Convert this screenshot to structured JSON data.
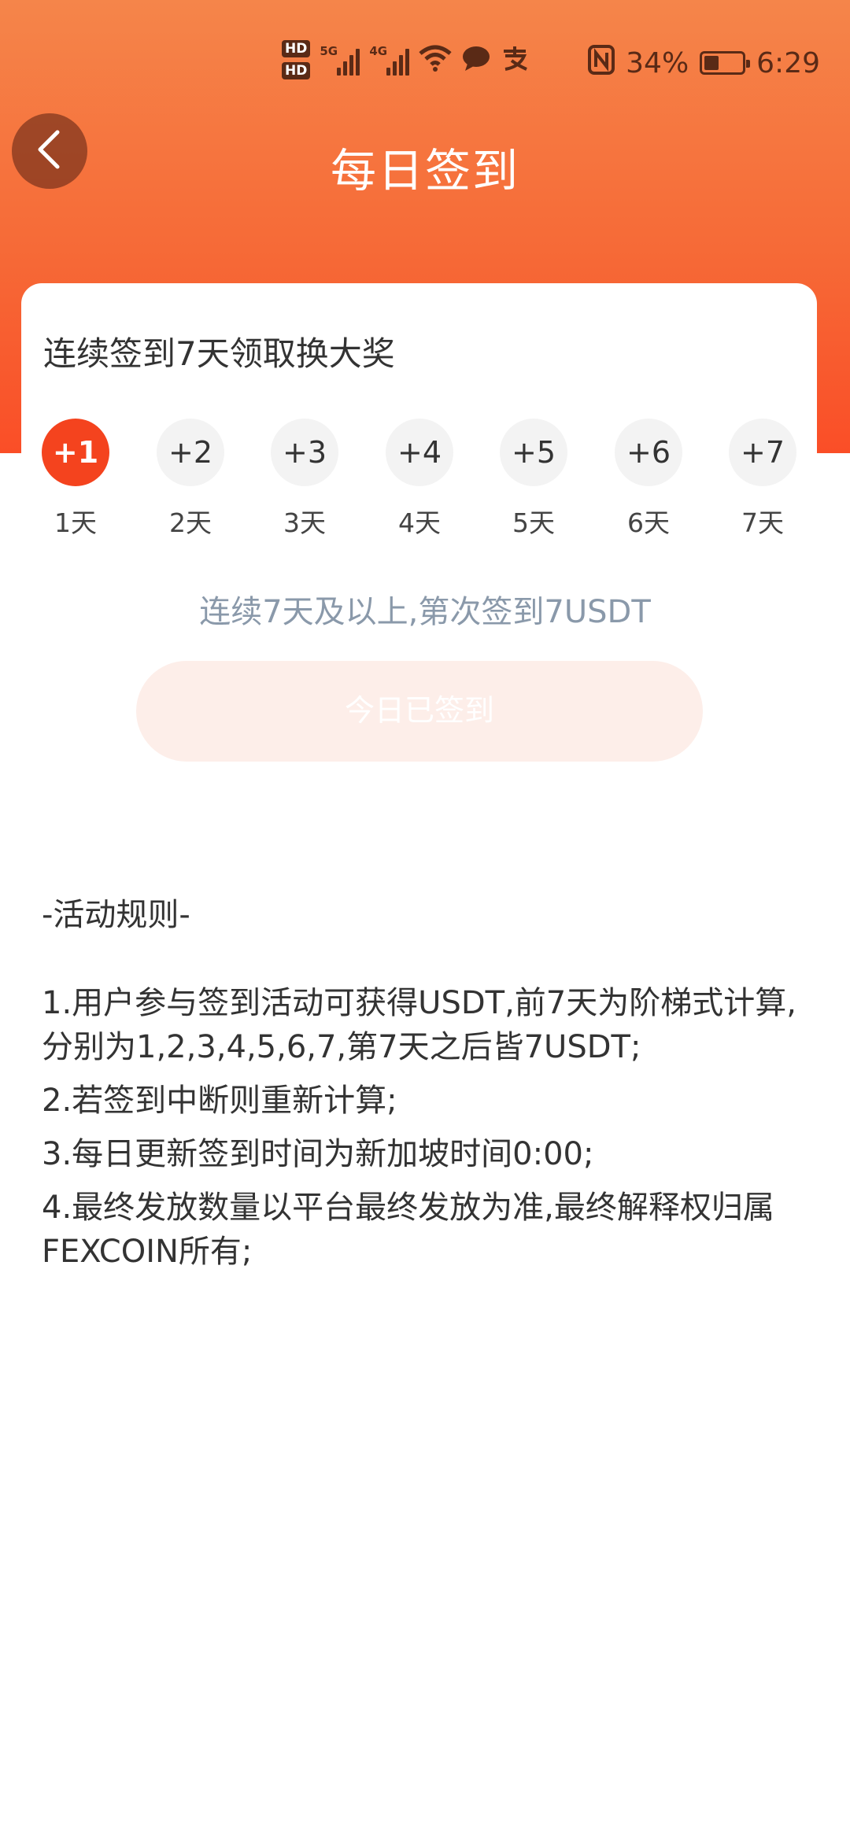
{
  "status_bar": {
    "hd1": "HD",
    "hd2": "HD",
    "net1": "5G",
    "net2": "4G",
    "battery": "34%",
    "time": "6:29"
  },
  "nav": {
    "title": "每日签到"
  },
  "card": {
    "title": "连续签到7天领取换大奖",
    "days": [
      {
        "bonus": "+1",
        "label": "1天",
        "active": true
      },
      {
        "bonus": "+2",
        "label": "2天",
        "active": false
      },
      {
        "bonus": "+3",
        "label": "3天",
        "active": false
      },
      {
        "bonus": "+4",
        "label": "4天",
        "active": false
      },
      {
        "bonus": "+5",
        "label": "5天",
        "active": false
      },
      {
        "bonus": "+6",
        "label": "6天",
        "active": false
      },
      {
        "bonus": "+7",
        "label": "7天",
        "active": false
      }
    ]
  },
  "hint": "连续7天及以上,第次签到7USDT",
  "signin_button": "今日已签到",
  "rules": {
    "title": "-活动规则-",
    "items": [
      "1.用户参与签到活动可获得USDT,前7天为阶梯式计算,分别为1,2,3,4,5,6,7,第7天之后皆7USDT;",
      "2.若签到中断则重新计算;",
      "3.每日更新签到时间为新加坡时间0:00;",
      "4.最终发放数量以平台最终发放为准,最终解释权归属FEXCOIN所有;"
    ]
  }
}
